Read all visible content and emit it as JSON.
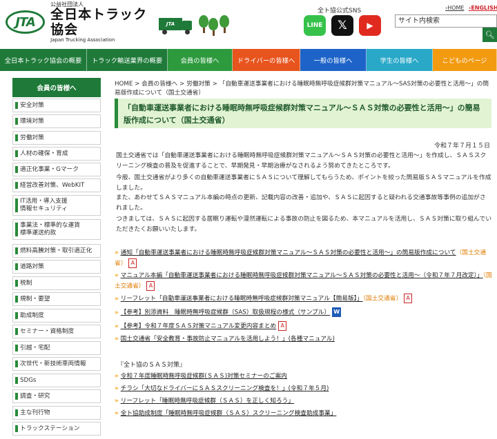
{
  "header": {
    "logo_mark": "JTA",
    "logo_sub": "公益社団法人",
    "logo_main": "全日本トラック協会",
    "logo_en": "Japan Trucking Association",
    "truck_mark": "JTA",
    "sns_label": "全ト協公式SNS",
    "sns": [
      {
        "name": "LINE",
        "icon": "line-icon",
        "color": "#36c24a"
      },
      {
        "name": "X",
        "icon": "x-icon",
        "color": "#111111"
      },
      {
        "name": "YouTube",
        "icon": "youtube-icon",
        "color": "#e12a1f"
      }
    ],
    "home_link": "HOME",
    "english_link": "ENGLISH",
    "search_placeholder": "サイト内検索"
  },
  "nav": [
    {
      "label": "全日本トラック協会の概要",
      "color": "#1f7a3a"
    },
    {
      "label": "トラック輸送業界の概要",
      "color": "#1f7a3a"
    },
    {
      "label": "会員の皆様へ",
      "color": "#2e9a3e"
    },
    {
      "label": "ドライバーの皆様へ",
      "color": "#e8541e"
    },
    {
      "label": "一般の皆様へ",
      "color": "#1e64c8"
    },
    {
      "label": "学生の皆様へ",
      "color": "#29a8c8"
    },
    {
      "label": "こどものページ",
      "color": "#f29a10"
    }
  ],
  "sidebar": {
    "heading": "会員の皆様へ",
    "items": [
      "安全対策",
      "環境対策",
      "労働対策",
      "人材の確保・育成",
      "適正化事業・Gマーク",
      "経営改善対策、WebKIT",
      "IT活用・導入支援\n情報セキュリティ",
      "事業法・標準的な運賃\n標準運送約款",
      "燃料高騰対策・取引適正化",
      "道路対策",
      "税制",
      "規制・要望",
      "助成制度",
      "セミナー・資格制度",
      "引越・宅配",
      "次世代・新技術車両情報",
      "SDGs",
      "調査・研究",
      "主な刊行物",
      "トラックステーション"
    ]
  },
  "breadcrumb": "HOME > 会員の皆様へ > 労働対策 > 「自動車運送事業者における睡眠時無呼吸症候群対策マニュアル～SAS対策の必要性と活用～」の簡易版作成について（国土交通省）",
  "title": "「自動車運送事業者における睡眠時無呼吸症候群対策マニュアル～ＳＡＳ対策の必要性と活用～」の簡易版作成について（国土交通省）",
  "date": "令和７年７月１５日",
  "paragraphs": [
    "国土交通省では「自動車運送事業者における睡眠時無呼吸症候群対策マニュアル～ＳＡＳ対策の必要性と活用～」を作成し、ＳＡＳスクリーニング検査の普及を促進することで、早期発見・早期治療がなされるよう努めてきたところです。",
    "今般、国土交通省がより多くの自動車運送事業者にＳＡＳについて理解してもらうため、ポイントを絞った簡易版ＳＡＳマニュアルを作成しました。",
    "また、あわせてＳＡＳマニュアル本編の時点の更新、記載内容の改善・追加や、ＳＡＳに起因すると疑われる交通事故等事例の追加がされました。",
    "つきましては、ＳＡＳに起因する居眠り運転や漫然運転による事故の防止を図るため、本マニュアルを活用し、ＳＡＳ対策に取り組んでいただきたくお願いいたします。"
  ],
  "links": [
    {
      "text": "通知「自動車運送事業者における睡眠時無呼吸症候群対策マニュアル～ＳＡＳ対策の必要性と活用～」の簡易版作成について",
      "source": "（国土交通省）",
      "icon": "pdf-icon"
    },
    {
      "text": "マニュアル本編「自動車運送事業者における睡眠時無呼吸症候群対策マニュアル～ＳＡＳ対策の必要性と活用～（令和７年７月改定）」",
      "source": "（国土交通省）",
      "icon": "pdf-icon"
    },
    {
      "text": "リーフレット「自動車運送事業者における睡眠時無呼吸症候群対策マニュアル【簡易版】」",
      "source": "（国土交通省）",
      "icon": "pdf-icon"
    },
    {
      "text": "【参考】別添資料　睡眠時無呼吸症候群（SAS）取扱規程の様式（サンプル）",
      "source": "",
      "icon": "word-icon"
    },
    {
      "text": "【参考】令和７年度ＳＡＳ対策マニュアル変更内容まとめ",
      "source": "",
      "icon": "pdf-icon"
    },
    {
      "text": "国土交通省「安全教育・事故防止マニュアルを活用しよう！」(各種マニュアル)",
      "source": "",
      "icon": ""
    }
  ],
  "sas_heading": "『全ト協のＳＡＳ対策』",
  "sas_links": [
    "令和７年度睡眠時無呼吸症候群(ＳＡＳ)対策セミナーのご案内",
    "チラシ「大切なドライバーにＳＡＳスクリーニング検査を！」(令和７年５月)",
    "リーフレット「睡眠時無呼吸症候群（ＳＡＳ）を正しく知ろう」",
    "全ト協助成制度「睡眠時無呼吸症候群（ＳＡＳ）スクリーニング検査助成事業」"
  ]
}
